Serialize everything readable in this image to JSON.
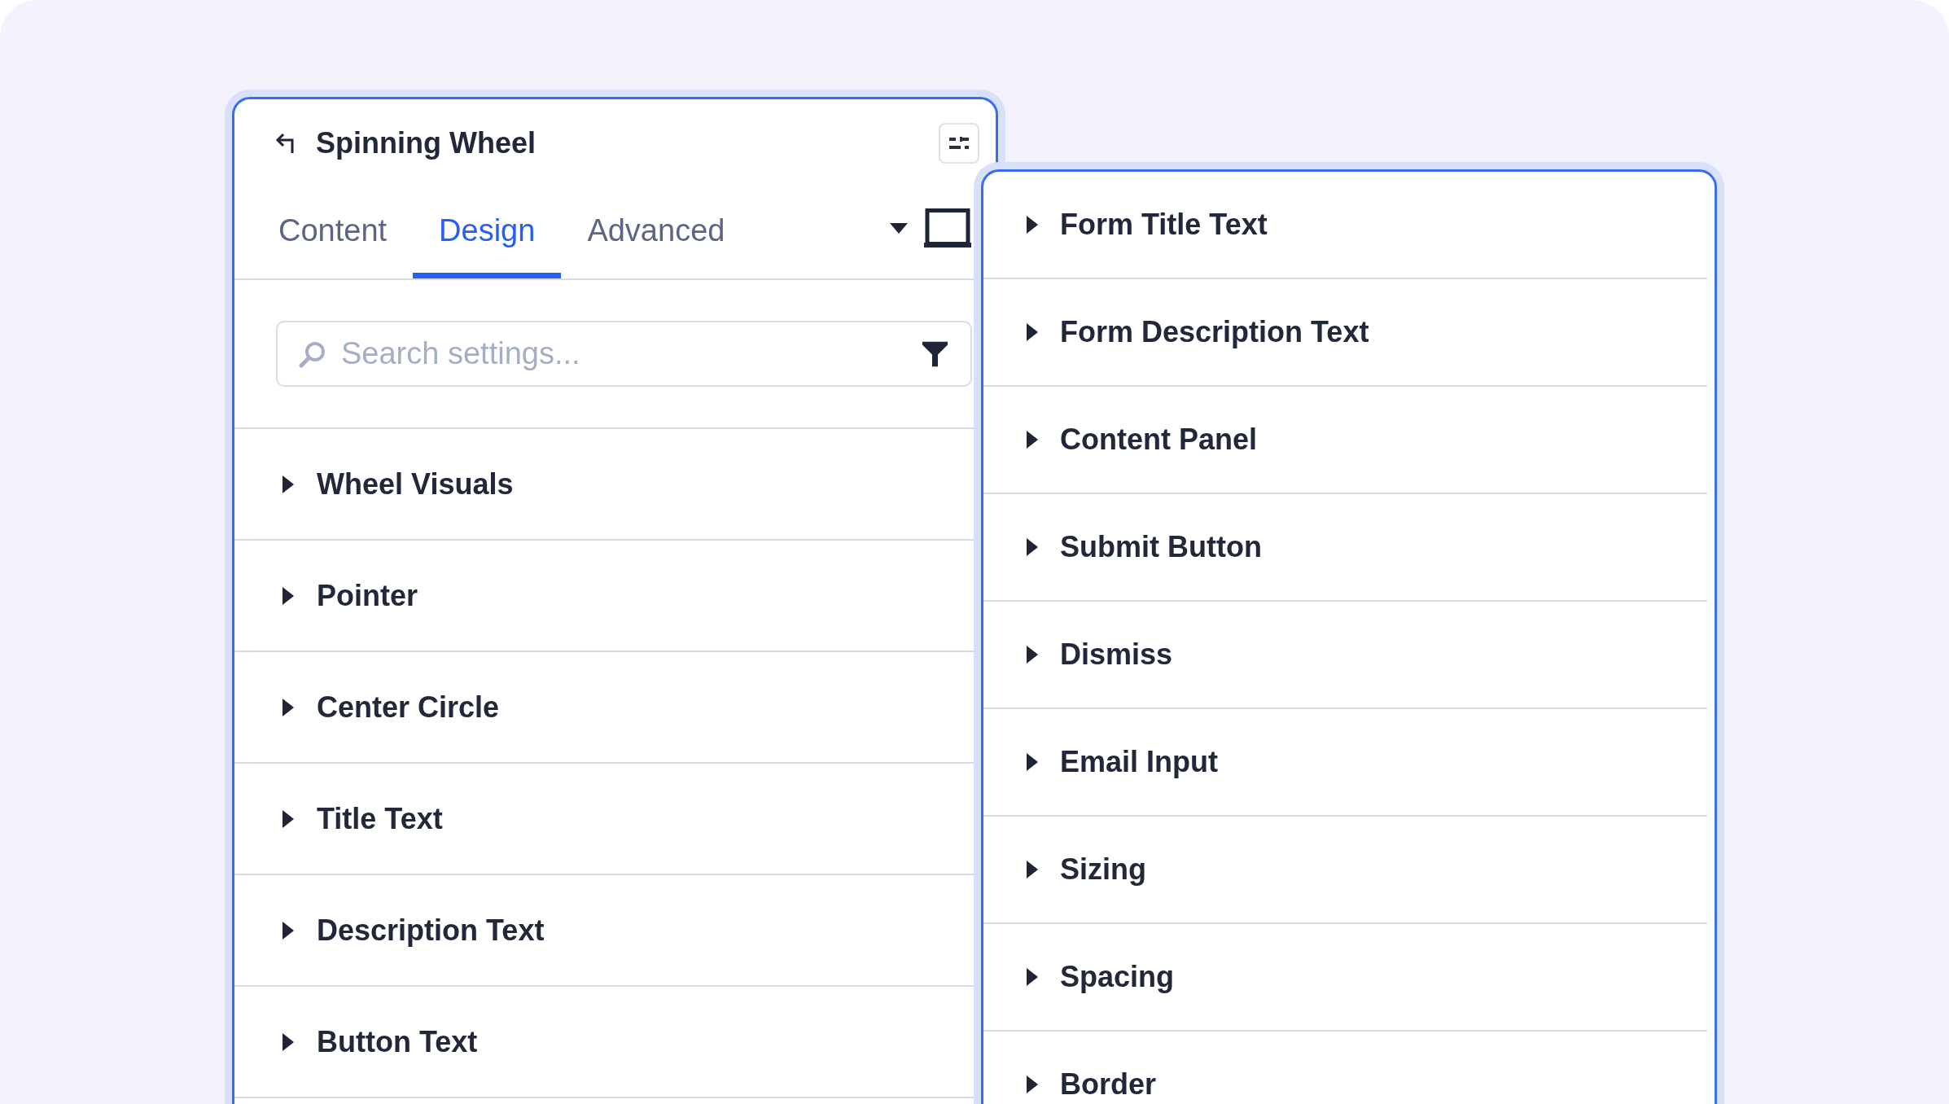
{
  "panel": {
    "title": "Spinning Wheel",
    "tabs": [
      {
        "label": "Content",
        "selected": false
      },
      {
        "label": "Design",
        "selected": true
      },
      {
        "label": "Advanced",
        "selected": false
      }
    ],
    "search": {
      "placeholder": "Search settings..."
    },
    "sections": [
      {
        "label": "Wheel Visuals",
        "expanded": false
      },
      {
        "label": "Pointer",
        "expanded": false
      },
      {
        "label": "Center Circle",
        "expanded": false
      },
      {
        "label": "Title Text",
        "expanded": false
      },
      {
        "label": "Description Text",
        "expanded": false
      },
      {
        "label": "Button Text",
        "expanded": false
      }
    ]
  },
  "flyout_panel": {
    "sections": [
      {
        "label": "Form Title Text",
        "expanded": false
      },
      {
        "label": "Form Description Text",
        "expanded": false
      },
      {
        "label": "Content Panel",
        "expanded": false
      },
      {
        "label": "Submit Button",
        "expanded": false
      },
      {
        "label": "Dismiss",
        "expanded": false
      },
      {
        "label": "Email Input",
        "expanded": false
      },
      {
        "label": "Sizing",
        "expanded": false
      },
      {
        "label": "Spacing",
        "expanded": false
      },
      {
        "label": "Border",
        "expanded": false
      }
    ]
  }
}
